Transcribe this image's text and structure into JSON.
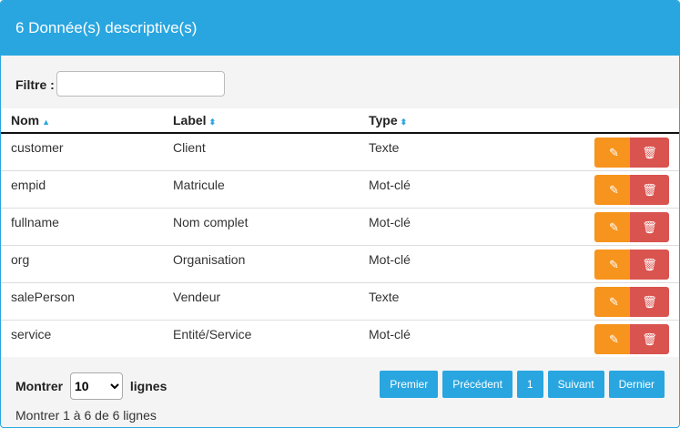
{
  "panel": {
    "title": "6 Donnée(s) descriptive(s)"
  },
  "filter": {
    "label": "Filtre :",
    "value": "",
    "placeholder": ""
  },
  "table": {
    "headers": {
      "nom": "Nom",
      "label": "Label",
      "type": "Type"
    },
    "rows": [
      {
        "nom": "customer",
        "label": "Client",
        "type": "Texte"
      },
      {
        "nom": "empid",
        "label": "Matricule",
        "type": "Mot-clé"
      },
      {
        "nom": "fullname",
        "label": "Nom complet",
        "type": "Mot-clé"
      },
      {
        "nom": "org",
        "label": "Organisation",
        "type": "Mot-clé"
      },
      {
        "nom": "salePerson",
        "label": "Vendeur",
        "type": "Texte"
      },
      {
        "nom": "service",
        "label": "Entité/Service",
        "type": "Mot-clé"
      }
    ]
  },
  "footer": {
    "show_prefix": "Montrer",
    "page_size": "10",
    "show_suffix": "lignes",
    "info": "Montrer 1 à 6 de 6 lignes",
    "pagination": {
      "first": "Premier",
      "prev": "Précédent",
      "current": "1",
      "next": "Suivant",
      "last": "Dernier"
    }
  },
  "icons": {
    "edit": "edit-icon",
    "delete": "trash-icon",
    "sort_asc": "sort-asc-icon",
    "sort_both": "sort-both-icon"
  },
  "colors": {
    "header": "#29a6e0",
    "edit": "#f7941d",
    "delete": "#d9534f",
    "pager": "#29a6e0"
  }
}
